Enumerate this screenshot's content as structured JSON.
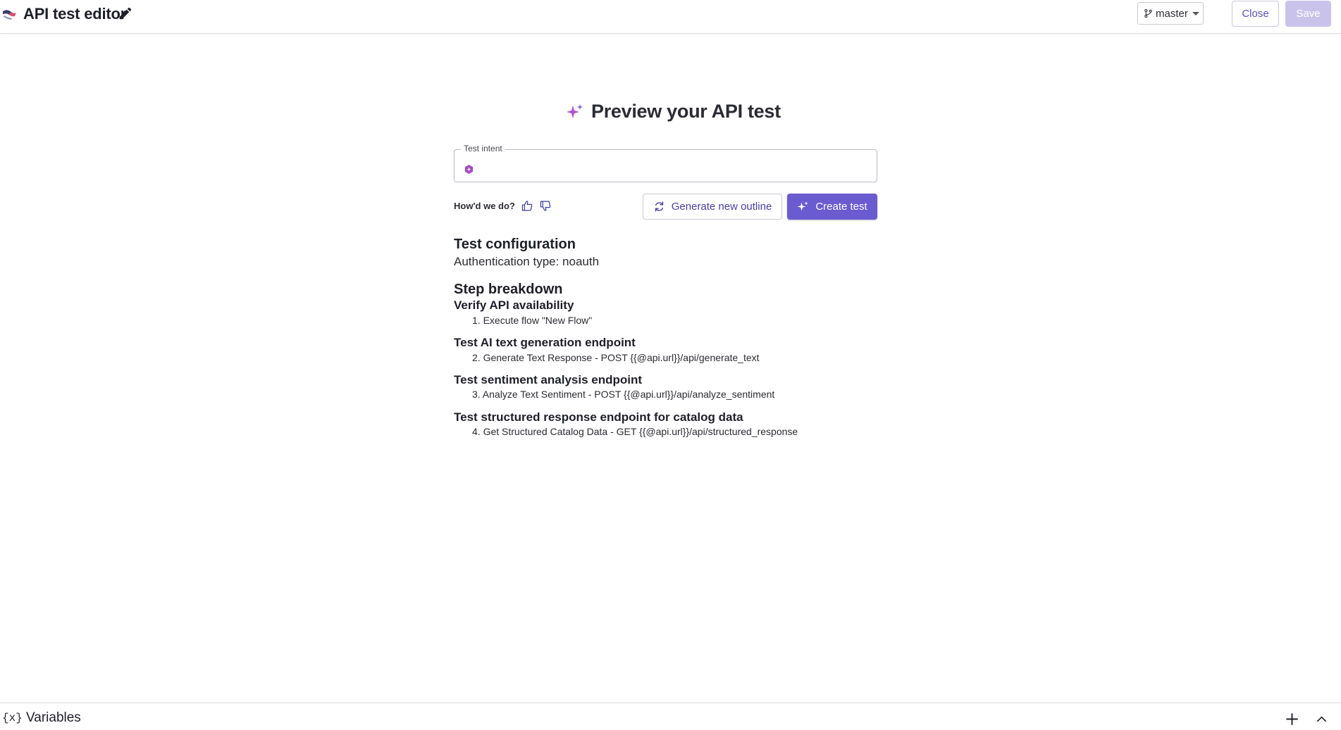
{
  "header": {
    "title": "API test editor",
    "branch": "master",
    "close_label": "Close",
    "save_label": "Save"
  },
  "main": {
    "title": "Preview your API test",
    "intent": {
      "legend": "Test intent",
      "value": ""
    },
    "feedback_label": "How'd we do?",
    "generate_outline_label": "Generate new outline",
    "create_test_label": "Create test",
    "config": {
      "heading": "Test configuration",
      "auth_line": "Authentication type: noauth"
    },
    "steps": {
      "heading": "Step breakdown",
      "groups": [
        {
          "title": "Verify API availability",
          "item": "1. Execute flow \"New Flow\""
        },
        {
          "title": "Test AI text generation endpoint",
          "item": "2. Generate Text Response - POST {{@api.url}}/api/generate_text"
        },
        {
          "title": "Test sentiment analysis endpoint",
          "item": "3. Analyze Text Sentiment - POST {{@api.url}}/api/analyze_sentiment"
        },
        {
          "title": "Test structured response endpoint for catalog data",
          "item": "4. Get Structured Catalog Data - GET {{@api.url}}/api/structured_response"
        }
      ]
    }
  },
  "footer": {
    "variables_icon": "{x}",
    "variables_label": "Variables"
  },
  "colors": {
    "accent": "#6b5bd1",
    "accent_text": "#4b3fa5",
    "save_disabled": "#c9c3ec",
    "sparkle": "#b04fc8"
  }
}
